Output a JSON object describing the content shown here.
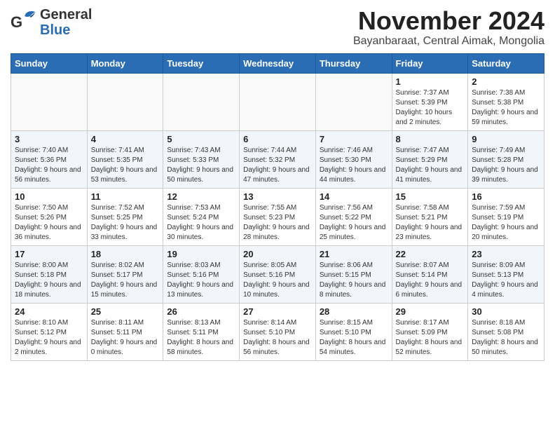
{
  "header": {
    "logo": {
      "general": "General",
      "blue": "Blue",
      "bird_unicode": "🐦"
    },
    "month_year": "November 2024",
    "location": "Bayanbaraat, Central Aimak, Mongolia"
  },
  "days_of_week": [
    "Sunday",
    "Monday",
    "Tuesday",
    "Wednesday",
    "Thursday",
    "Friday",
    "Saturday"
  ],
  "weeks": [
    {
      "days": [
        {
          "date": "",
          "info": ""
        },
        {
          "date": "",
          "info": ""
        },
        {
          "date": "",
          "info": ""
        },
        {
          "date": "",
          "info": ""
        },
        {
          "date": "",
          "info": ""
        },
        {
          "date": "1",
          "info": "Sunrise: 7:37 AM\nSunset: 5:39 PM\nDaylight: 10 hours and 2 minutes."
        },
        {
          "date": "2",
          "info": "Sunrise: 7:38 AM\nSunset: 5:38 PM\nDaylight: 9 hours and 59 minutes."
        }
      ]
    },
    {
      "days": [
        {
          "date": "3",
          "info": "Sunrise: 7:40 AM\nSunset: 5:36 PM\nDaylight: 9 hours and 56 minutes."
        },
        {
          "date": "4",
          "info": "Sunrise: 7:41 AM\nSunset: 5:35 PM\nDaylight: 9 hours and 53 minutes."
        },
        {
          "date": "5",
          "info": "Sunrise: 7:43 AM\nSunset: 5:33 PM\nDaylight: 9 hours and 50 minutes."
        },
        {
          "date": "6",
          "info": "Sunrise: 7:44 AM\nSunset: 5:32 PM\nDaylight: 9 hours and 47 minutes."
        },
        {
          "date": "7",
          "info": "Sunrise: 7:46 AM\nSunset: 5:30 PM\nDaylight: 9 hours and 44 minutes."
        },
        {
          "date": "8",
          "info": "Sunrise: 7:47 AM\nSunset: 5:29 PM\nDaylight: 9 hours and 41 minutes."
        },
        {
          "date": "9",
          "info": "Sunrise: 7:49 AM\nSunset: 5:28 PM\nDaylight: 9 hours and 39 minutes."
        }
      ]
    },
    {
      "days": [
        {
          "date": "10",
          "info": "Sunrise: 7:50 AM\nSunset: 5:26 PM\nDaylight: 9 hours and 36 minutes."
        },
        {
          "date": "11",
          "info": "Sunrise: 7:52 AM\nSunset: 5:25 PM\nDaylight: 9 hours and 33 minutes."
        },
        {
          "date": "12",
          "info": "Sunrise: 7:53 AM\nSunset: 5:24 PM\nDaylight: 9 hours and 30 minutes."
        },
        {
          "date": "13",
          "info": "Sunrise: 7:55 AM\nSunset: 5:23 PM\nDaylight: 9 hours and 28 minutes."
        },
        {
          "date": "14",
          "info": "Sunrise: 7:56 AM\nSunset: 5:22 PM\nDaylight: 9 hours and 25 minutes."
        },
        {
          "date": "15",
          "info": "Sunrise: 7:58 AM\nSunset: 5:21 PM\nDaylight: 9 hours and 23 minutes."
        },
        {
          "date": "16",
          "info": "Sunrise: 7:59 AM\nSunset: 5:19 PM\nDaylight: 9 hours and 20 minutes."
        }
      ]
    },
    {
      "days": [
        {
          "date": "17",
          "info": "Sunrise: 8:00 AM\nSunset: 5:18 PM\nDaylight: 9 hours and 18 minutes."
        },
        {
          "date": "18",
          "info": "Sunrise: 8:02 AM\nSunset: 5:17 PM\nDaylight: 9 hours and 15 minutes."
        },
        {
          "date": "19",
          "info": "Sunrise: 8:03 AM\nSunset: 5:16 PM\nDaylight: 9 hours and 13 minutes."
        },
        {
          "date": "20",
          "info": "Sunrise: 8:05 AM\nSunset: 5:16 PM\nDaylight: 9 hours and 10 minutes."
        },
        {
          "date": "21",
          "info": "Sunrise: 8:06 AM\nSunset: 5:15 PM\nDaylight: 9 hours and 8 minutes."
        },
        {
          "date": "22",
          "info": "Sunrise: 8:07 AM\nSunset: 5:14 PM\nDaylight: 9 hours and 6 minutes."
        },
        {
          "date": "23",
          "info": "Sunrise: 8:09 AM\nSunset: 5:13 PM\nDaylight: 9 hours and 4 minutes."
        }
      ]
    },
    {
      "days": [
        {
          "date": "24",
          "info": "Sunrise: 8:10 AM\nSunset: 5:12 PM\nDaylight: 9 hours and 2 minutes."
        },
        {
          "date": "25",
          "info": "Sunrise: 8:11 AM\nSunset: 5:11 PM\nDaylight: 9 hours and 0 minutes."
        },
        {
          "date": "26",
          "info": "Sunrise: 8:13 AM\nSunset: 5:11 PM\nDaylight: 8 hours and 58 minutes."
        },
        {
          "date": "27",
          "info": "Sunrise: 8:14 AM\nSunset: 5:10 PM\nDaylight: 8 hours and 56 minutes."
        },
        {
          "date": "28",
          "info": "Sunrise: 8:15 AM\nSunset: 5:10 PM\nDaylight: 8 hours and 54 minutes."
        },
        {
          "date": "29",
          "info": "Sunrise: 8:17 AM\nSunset: 5:09 PM\nDaylight: 8 hours and 52 minutes."
        },
        {
          "date": "30",
          "info": "Sunrise: 8:18 AM\nSunset: 5:08 PM\nDaylight: 8 hours and 50 minutes."
        }
      ]
    }
  ]
}
